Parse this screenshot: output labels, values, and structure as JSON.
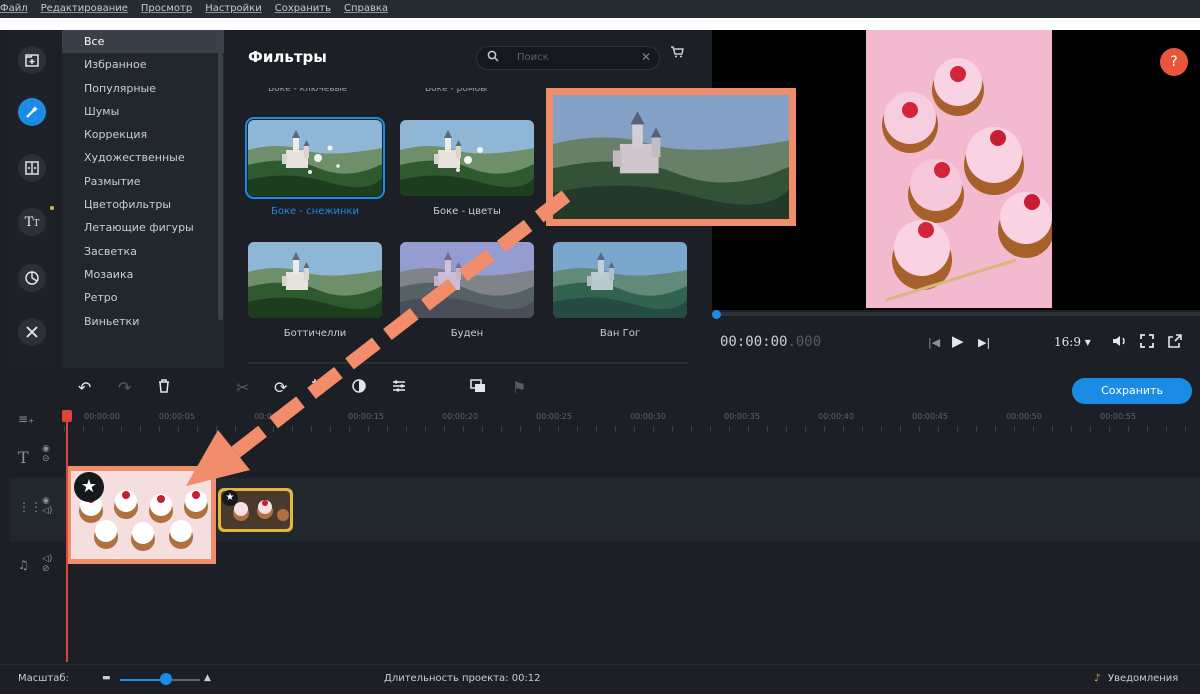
{
  "menu": [
    {
      "label": "Файл"
    },
    {
      "label": "Редактирование"
    },
    {
      "label": "Просмотр"
    },
    {
      "label": "Настройки"
    },
    {
      "label": "Сохранить"
    },
    {
      "label": "Справка"
    }
  ],
  "tools": [
    "import-icon",
    "filters-icon",
    "transitions-icon",
    "titles-icon",
    "stickers-icon",
    "more-tools-icon"
  ],
  "categories": [
    {
      "label": "Все",
      "selected": true
    },
    {
      "label": "Избранное"
    },
    {
      "label": "Популярные"
    },
    {
      "label": "Шумы"
    },
    {
      "label": "Коррекция"
    },
    {
      "label": "Художественные"
    },
    {
      "label": "Размытие"
    },
    {
      "label": "Цветофильтры"
    },
    {
      "label": "Летающие фигуры"
    },
    {
      "label": "Засветка"
    },
    {
      "label": "Мозаика"
    },
    {
      "label": "Ретро"
    },
    {
      "label": "Виньетки"
    }
  ],
  "filters": {
    "title": "Фильтры",
    "search_placeholder": "Поиск",
    "cut_labels": [
      "Боке - ключевые",
      "Боке - ромбы"
    ],
    "items": [
      {
        "label": "Боке - снежинки",
        "selected": true
      },
      {
        "label": "Боке - цветы"
      },
      {
        "label": "Боттичелли"
      },
      {
        "label": "Буден"
      },
      {
        "label": "Ван Гог"
      }
    ]
  },
  "player": {
    "timecode_main": "00:00:00",
    "timecode_ms": ".000",
    "aspect": "16:9 ▾",
    "help": "?"
  },
  "timeline": {
    "save_label": "Сохранить",
    "ticks": [
      "00:00:00",
      "00:00:05",
      "00:00:10",
      "00:00:15",
      "00:00:20",
      "00:00:25",
      "00:00:30",
      "00:00:35",
      "00:00:40",
      "00:00:45",
      "00:00:50",
      "00:00:55"
    ]
  },
  "status": {
    "scale_label": "Масштаб:",
    "duration": "Длительность проекта: 00:12",
    "notifications": "Уведомления"
  },
  "colors": {
    "accent": "#1b8ce6",
    "annotation": "#f18d6a",
    "help": "#e8553b",
    "playhead": "#d8463c",
    "clip_selected": "#e1b83a"
  }
}
